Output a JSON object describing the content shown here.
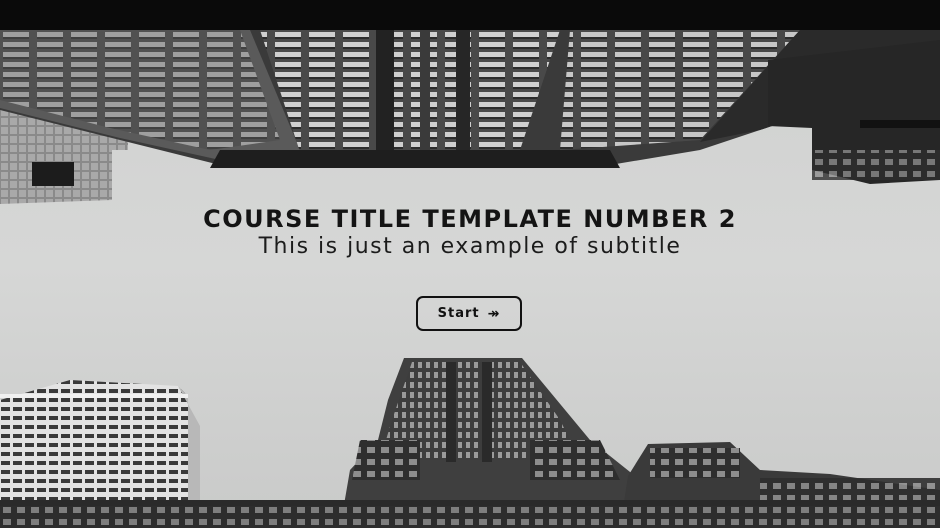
{
  "slide": {
    "title": "COURSE TITLE TEMPLATE NUMBER 2",
    "subtitle": "This is just an example of subtitle",
    "start_button": {
      "label": "Start",
      "icon": "double-arrow-right-icon",
      "icon_glyph": "↠"
    },
    "background": {
      "description_icon": "city-buildings-looking-up-photo",
      "sky_color": "#d2d3d2"
    }
  }
}
